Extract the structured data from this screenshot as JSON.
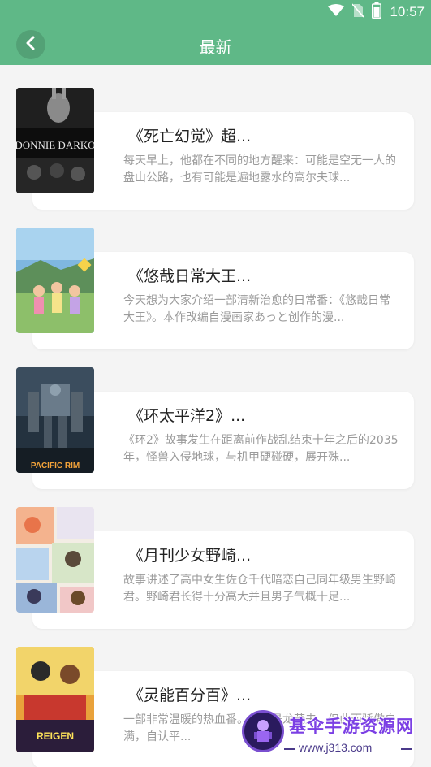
{
  "status_bar": {
    "time": "10:57",
    "icons": [
      "wifi-icon",
      "no-sim-icon",
      "battery-icon"
    ]
  },
  "app_bar": {
    "title": "最新",
    "back_icon": "back-arrow-icon"
  },
  "colors": {
    "header": "#5fb887",
    "background": "#f4f4f4",
    "card": "#ffffff",
    "title": "#222222",
    "description": "#9b9b9b"
  },
  "items": [
    {
      "title": "《死亡幻觉》超...",
      "description": "每天早上，他都在不同的地方醒来：可能是空无一人的盘山公路，也有可能是遍地露水的高尔夫球...",
      "cover_text": "DONNIE DARKO"
    },
    {
      "title": "《悠哉日常大王...",
      "description": "今天想为大家介绍一部清新治愈的日常番：《悠哉日常大王》。本作改编自漫画家あっと创作的漫...",
      "cover_text": ""
    },
    {
      "title": "《环太平洋2》...",
      "description": "《环2》故事发生在距离前作战乱结束十年之后的2035年，怪兽入侵地球，与机甲硬碰硬，展开殊...",
      "cover_text": "PACIFIC RIM"
    },
    {
      "title": "《月刊少女野崎...",
      "description": "故事讲述了高中女生佐仓千代暗恋自己同年级男生野崎君。野崎君长得十分高大并且男子气概十足...",
      "cover_text": ""
    },
    {
      "title": "《灵能百分百》...",
      "description": "一部非常温暖的热血番。主角是龙茂夫，但此而骄傲自满，自认平...",
      "cover_text": "REIGEN"
    }
  ],
  "watermark": {
    "name": "基伞手游资源网",
    "url": "www.j313.com"
  }
}
